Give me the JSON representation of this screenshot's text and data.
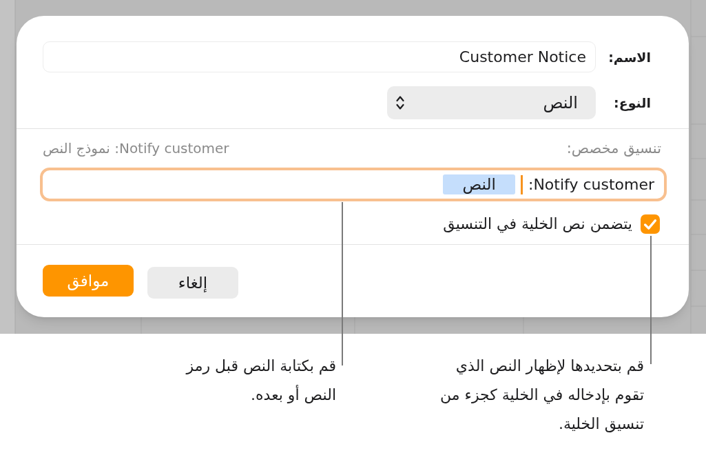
{
  "dialog": {
    "name_field": {
      "label": "الاسم:",
      "value": "Customer Notice"
    },
    "type_popup": {
      "label": "النوع:",
      "value": "النص"
    },
    "custom_format": {
      "label": "تنسيق مخصص:",
      "sample": "Notify customer: نموذج النص",
      "field": {
        "text": "Notify customer:",
        "token": "النص",
        "focused": true
      }
    },
    "include_cell_text": {
      "label": "يتضمن نص الخلية في التنسيق",
      "checked": true
    },
    "buttons": [
      {
        "label": "إلغاء",
        "kind": "secondary"
      },
      {
        "label": "موافق",
        "kind": "primary"
      }
    ]
  },
  "callouts": [
    {
      "text": "قم بتحديدها لإظهار النص الذي تقوم بإدخاله في الخلية كجزء من تنسيق الخلية."
    },
    {
      "text": "قم بكتابة النص قبل رمز النص أو بعده."
    }
  ]
}
